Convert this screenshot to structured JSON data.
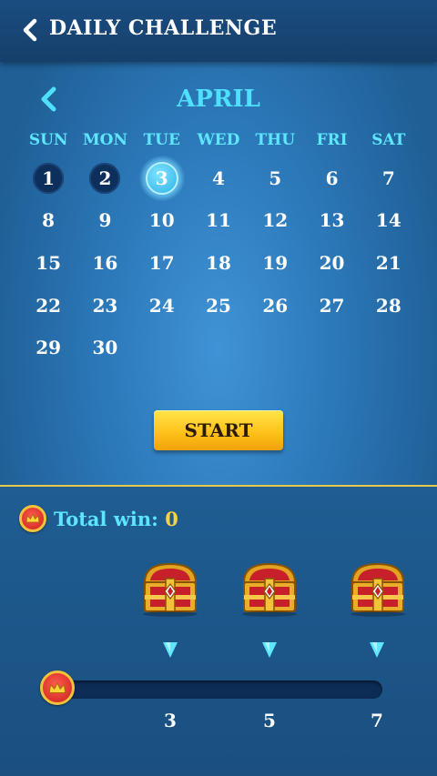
{
  "header": {
    "title": "DAILY CHALLENGE",
    "back_icon": "chevron-left-icon"
  },
  "calendar": {
    "month": "APRIL",
    "prev_icon": "chevron-left-icon",
    "weekdays": [
      "SUN",
      "MON",
      "TUE",
      "WED",
      "THU",
      "FRI",
      "SAT"
    ],
    "weeks": [
      [
        "1",
        "2",
        "3",
        "4",
        "5",
        "6",
        "7"
      ],
      [
        "8",
        "9",
        "10",
        "11",
        "12",
        "13",
        "14"
      ],
      [
        "15",
        "16",
        "17",
        "18",
        "19",
        "20",
        "21"
      ],
      [
        "22",
        "23",
        "24",
        "25",
        "26",
        "27",
        "28"
      ],
      [
        "29",
        "30"
      ]
    ],
    "completed_days": [
      "1",
      "2"
    ],
    "today": "3"
  },
  "start_button": {
    "label": "START"
  },
  "rewards": {
    "total_label": "Total win:",
    "total_value": "0",
    "crown_icon": "crown-icon",
    "chest_icon": "treasure-chest-icon",
    "progress": 0,
    "milestones": [
      "3",
      "5",
      "7"
    ]
  },
  "colors": {
    "accent_cyan": "#5fe6ff",
    "button_yellow": "#ffc21a",
    "gold": "#ffd23a",
    "divider": "#e8c94a"
  }
}
